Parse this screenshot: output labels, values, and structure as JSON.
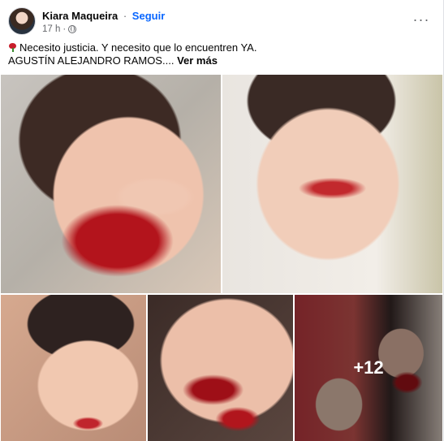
{
  "post": {
    "author": "Kiara Maqueira",
    "separator": "·",
    "follow_label": "Seguir",
    "time": "17 h",
    "time_separator": "·",
    "audience_icon": "globe-icon",
    "more_icon": "more-options-icon",
    "more_label": "···",
    "text_line1": "Necesito justicia. Y necesito que lo encuentren YA.",
    "text_line2": "AGUSTÍN ALEJANDRO RAMOS....",
    "see_more": "Ver más",
    "emoji_icon": "rose-icon"
  },
  "gallery": {
    "extra_count": "+12"
  },
  "colors": {
    "link": "#0866ff",
    "text": "#050505",
    "secondary": "#65676b"
  }
}
